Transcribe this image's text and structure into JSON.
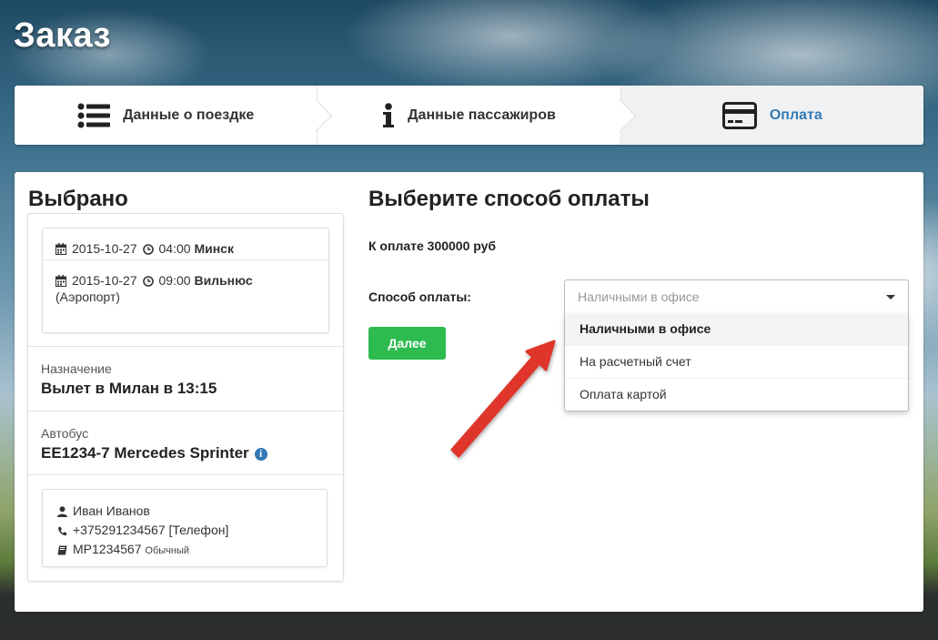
{
  "page": {
    "title": "Заказ"
  },
  "steps": [
    {
      "label": "Данные о поездке",
      "icon": "list-icon"
    },
    {
      "label": "Данные пассажиров",
      "icon": "info-icon"
    },
    {
      "label": "Оплата",
      "icon": "credit-card-icon",
      "active": true
    }
  ],
  "summary": {
    "title": "Выбрано",
    "departure": {
      "date": "2015-10-27",
      "time": "04:00",
      "city": "Минск"
    },
    "arrival": {
      "date": "2015-10-27",
      "time": "09:00",
      "city": "Вильнюс",
      "city_note": "(Аэропорт)"
    },
    "destination": {
      "label": "Назначение",
      "value": "Вылет в Милан в 13:15"
    },
    "bus": {
      "label": "Автобус",
      "value": "EE1234-7 Mercedes Sprinter"
    },
    "passenger": {
      "name": "Иван Иванов",
      "phone": "+375291234567",
      "phone_type": "[Телефон]",
      "document": "MP1234567",
      "document_type": "Обычный"
    }
  },
  "payment": {
    "title": "Выберите способ оплаты",
    "amount_text": "К оплате 300000 руб",
    "method_label": "Способ оплаты:",
    "select_placeholder": "Наличными в офисе",
    "options": [
      "Наличными в офисе",
      "На расчетный счет",
      "Оплата картой"
    ],
    "selected_index": 0,
    "next_label": "Далее"
  },
  "colors": {
    "accent": "#337ab7",
    "button": "#2dbb4f",
    "arrow": "#e0352b"
  }
}
